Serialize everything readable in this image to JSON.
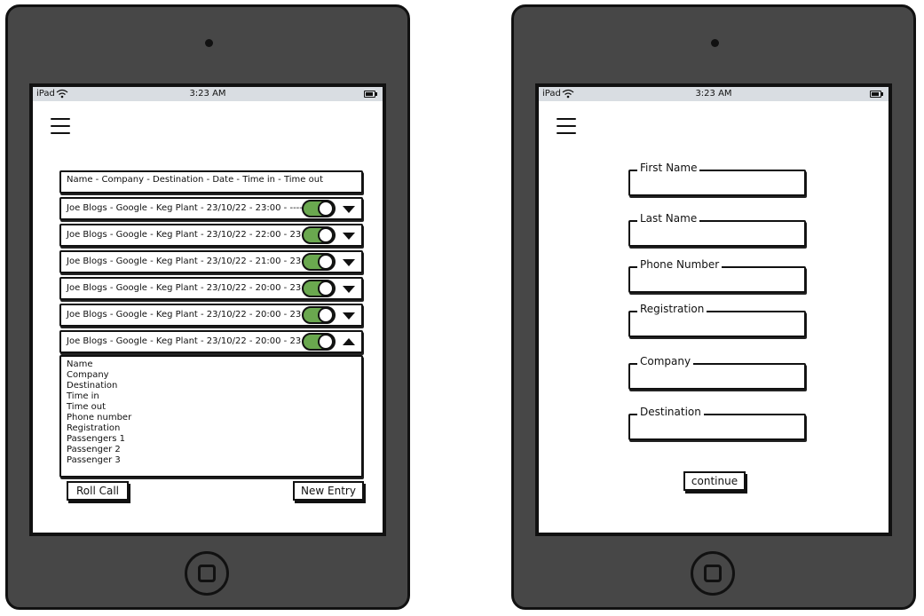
{
  "status": {
    "carrier": "iPad",
    "time": "3:23 AM"
  },
  "list": {
    "header": "Name - Company - Destination - Date - Time in - Time out",
    "rows": [
      "Joe Blogs - Google - Keg Plant - 23/10/22 - 23:00 - ----",
      "Joe Blogs - Google - Keg Plant - 23/10/22 - 22:00 - 23:00",
      "Joe Blogs - Google - Keg Plant - 23/10/22 - 21:00 - 23:00",
      "Joe Blogs - Google - Keg Plant - 23/10/22 - 20:00 - 23:00",
      "Joe Blogs - Google - Keg Plant - 23/10/22 - 20:00 - 23:00",
      "Joe Blogs - Google - Keg Plant - 23/10/22 - 20:00 - 23:00"
    ],
    "details": [
      "Name",
      "Company",
      "Destination",
      "Time in",
      "Time out",
      "Phone number",
      "Registration",
      "Passengers 1",
      "Passenger 2",
      "Passenger 3"
    ]
  },
  "buttons": {
    "roll_call": "Roll Call",
    "new_entry": "New Entry",
    "continue": "continue"
  },
  "form": {
    "fields": [
      "First Name",
      "Last Name",
      "Phone Number",
      "Registration",
      "Company",
      "Destination"
    ]
  },
  "colors": {
    "device": "#474747",
    "toggle_on": "#6aa84f",
    "statusbar": "#d9dde2"
  }
}
